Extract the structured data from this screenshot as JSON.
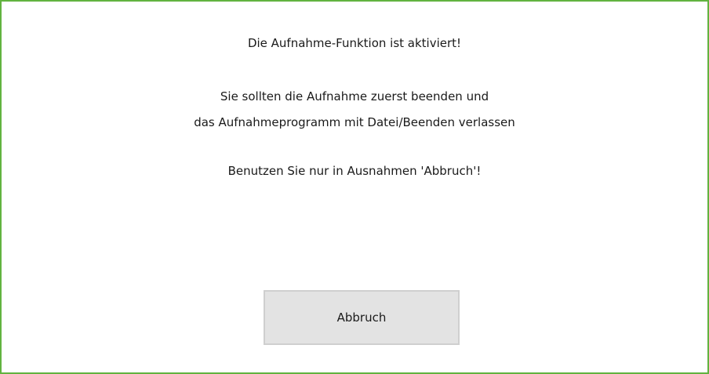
{
  "dialog": {
    "message_line1": "Die Aufnahme-Funktion ist aktiviert!",
    "message_line2": "Sie sollten die Aufnahme zuerst beenden und",
    "message_line3": "das Aufnahmeprogramm mit Datei/Beenden verlassen",
    "message_line4": "Benutzen Sie nur in Ausnahmen 'Abbruch'!",
    "cancel_label": "Abbruch"
  },
  "colors": {
    "border": "#62b33f",
    "button_bg": "#e3e3e3",
    "button_border": "#cfcfcf"
  }
}
